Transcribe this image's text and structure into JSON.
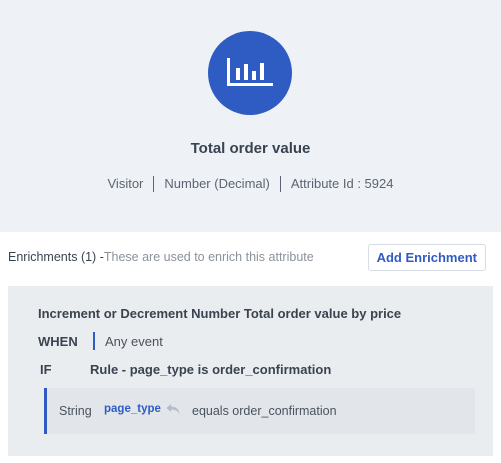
{
  "attribute": {
    "icon": "bar-chart-icon",
    "title": "Total order value",
    "entity": "Visitor",
    "data_type": "Number (Decimal)",
    "attribute_id_text": "Attribute Id : 5924"
  },
  "enrichments": {
    "label": "Enrichments (1) -",
    "description": "These are used to enrich this attribute",
    "add_button_label": "Add Enrichment"
  },
  "rule": {
    "title": "Increment or Decrement Number Total order value by price",
    "when_keyword": "WHEN",
    "when_value": "Any event",
    "if_keyword": "IF",
    "if_rule": "Rule - page_type is order_confirmation",
    "condition": {
      "type": "String",
      "field": "page_type",
      "field_icon": "reply-arrow-icon",
      "operator_value": "equals order_confirmation"
    }
  },
  "colors": {
    "accent": "#2f5cc2",
    "header_bg": "#eef2f6",
    "panel_bg": "#eaedf0"
  }
}
